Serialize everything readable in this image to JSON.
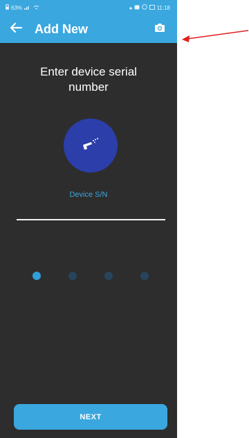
{
  "status_bar": {
    "left": "63%",
    "time": "11:18"
  },
  "app_bar": {
    "title": "Add New",
    "back_icon": "arrow-left-icon",
    "camera_icon": "camera-icon"
  },
  "content": {
    "headline": "Enter device serial number",
    "device_icon": "device-icon",
    "serial_label": "Device S/N",
    "serial_value": ""
  },
  "pager": {
    "total": 4,
    "current": 1
  },
  "footer": {
    "next_label": "NEXT"
  },
  "colors": {
    "accent": "#3aa7df",
    "background": "#2d2d2d",
    "circle": "#2c3ea9",
    "annotation": "#e02020"
  }
}
